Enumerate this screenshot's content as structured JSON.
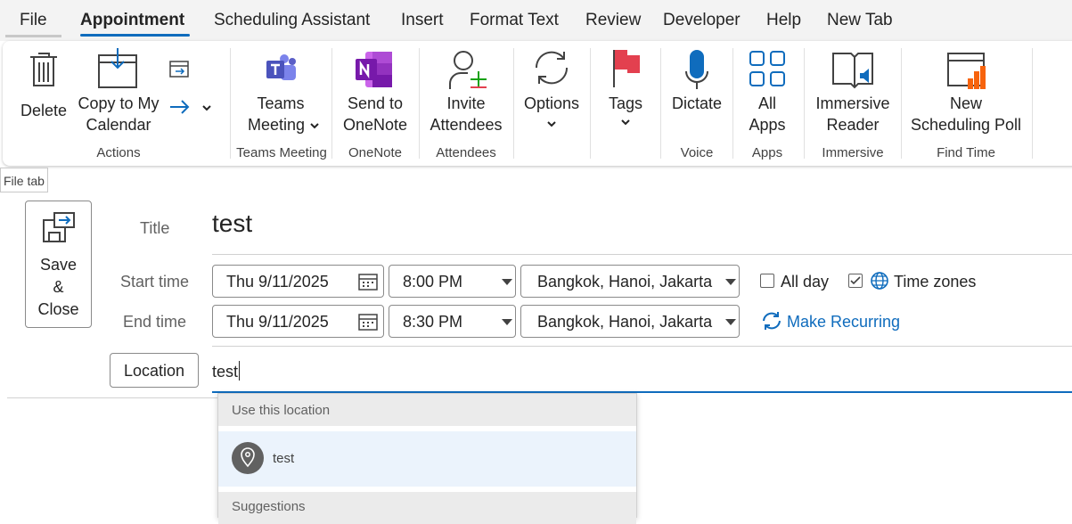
{
  "tabs": [
    "File",
    "Appointment",
    "Scheduling Assistant",
    "Insert",
    "Format Text",
    "Review",
    "Developer",
    "Help",
    "New Tab"
  ],
  "ribbon": {
    "delete": "Delete",
    "copy_line1": "Copy to My",
    "copy_line2": "Calendar",
    "teams_line1": "Teams",
    "teams_line2": "Meeting",
    "onenote_line1": "Send to",
    "onenote_line2": "OneNote",
    "invite_line1": "Invite",
    "invite_line2": "Attendees",
    "options": "Options",
    "tags": "Tags",
    "dictate": "Dictate",
    "apps_line1": "All",
    "apps_line2": "Apps",
    "immersive_line1": "Immersive",
    "immersive_line2": "Reader",
    "poll_line1": "New",
    "poll_line2": "Scheduling Poll",
    "groups": {
      "actions": "Actions",
      "teams": "Teams Meeting",
      "onenote": "OneNote",
      "attendees": "Attendees",
      "voice": "Voice",
      "apps": "Apps",
      "immersive": "Immersive",
      "findtime": "Find Time"
    },
    "colors": {
      "teams": "#5b5fc7",
      "onenote": "#7719aa",
      "tags_flag": "#e3404f",
      "accent": "#0f6cbd"
    }
  },
  "tooltip": "File tab",
  "save_close": {
    "line1": "Save",
    "line2": "&",
    "line3": "Close"
  },
  "form": {
    "title_label": "Title",
    "title_value": "test",
    "start_label": "Start time",
    "end_label": "End time",
    "start_date": "Thu 9/11/2025",
    "start_time": "8:00 PM",
    "start_tz": "Bangkok, Hanoi, Jakarta",
    "end_date": "Thu 9/11/2025",
    "end_time": "8:30 PM",
    "end_tz": "Bangkok, Hanoi, Jakarta",
    "all_day": "All day",
    "time_zones": "Time zones",
    "make_recurring": "Make Recurring",
    "location_button": "Location",
    "location_value": "test"
  },
  "location_dropdown": {
    "use_header": "Use this location",
    "item": "test",
    "suggestions_header": "Suggestions"
  }
}
